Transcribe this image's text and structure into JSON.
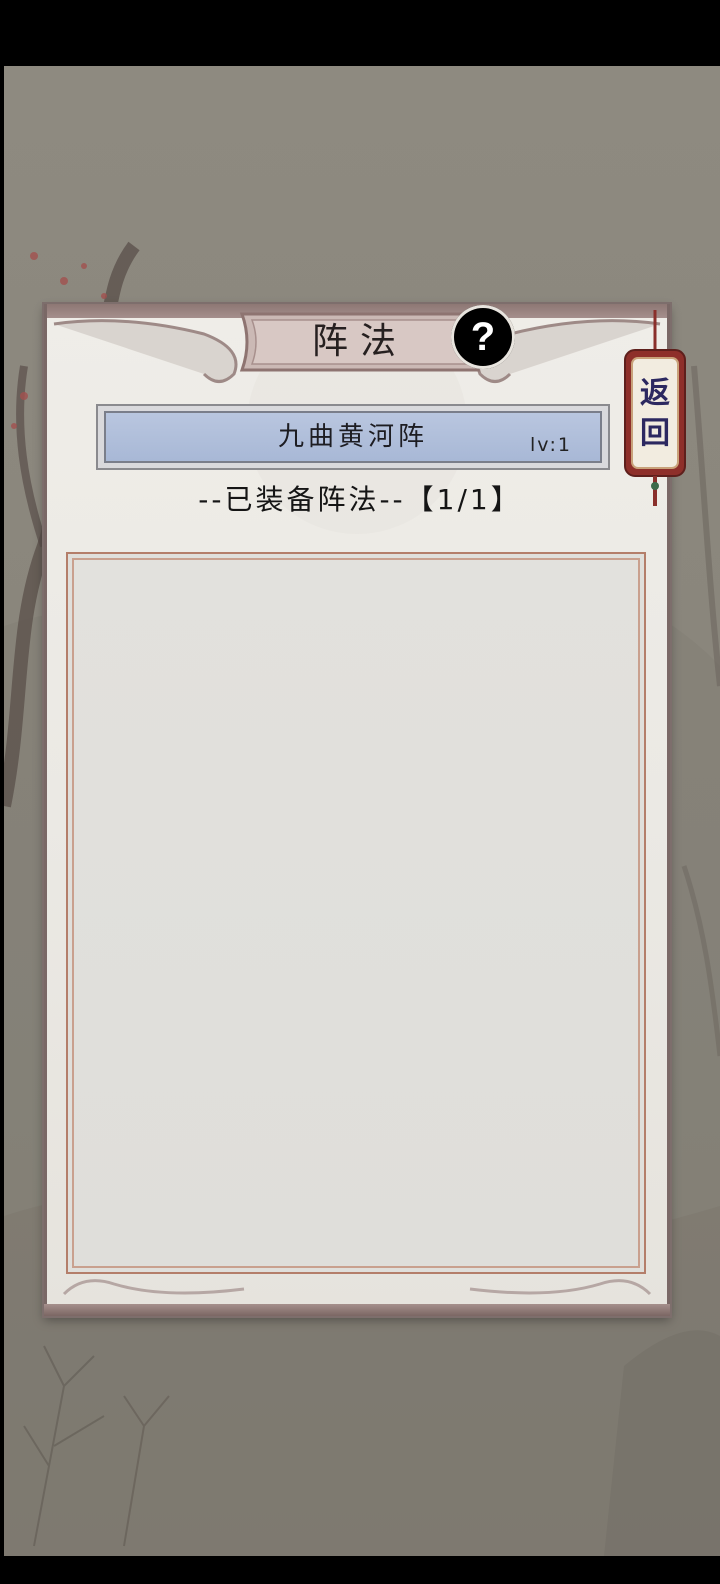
{
  "panel": {
    "title": "阵法",
    "help_icon": "question-mark-icon",
    "help_label": "?"
  },
  "back_button": {
    "label": "返回"
  },
  "formation": {
    "name": "九曲黄河阵",
    "level": "lv:1"
  },
  "equipped": {
    "label": "--已装备阵法--【1/1】"
  },
  "colors": {
    "background": "#8a867c",
    "panel": "#ece9e4",
    "formation_bar": "#aebbd8",
    "frame": "#b47e6a",
    "back_text": "#2c2860"
  }
}
